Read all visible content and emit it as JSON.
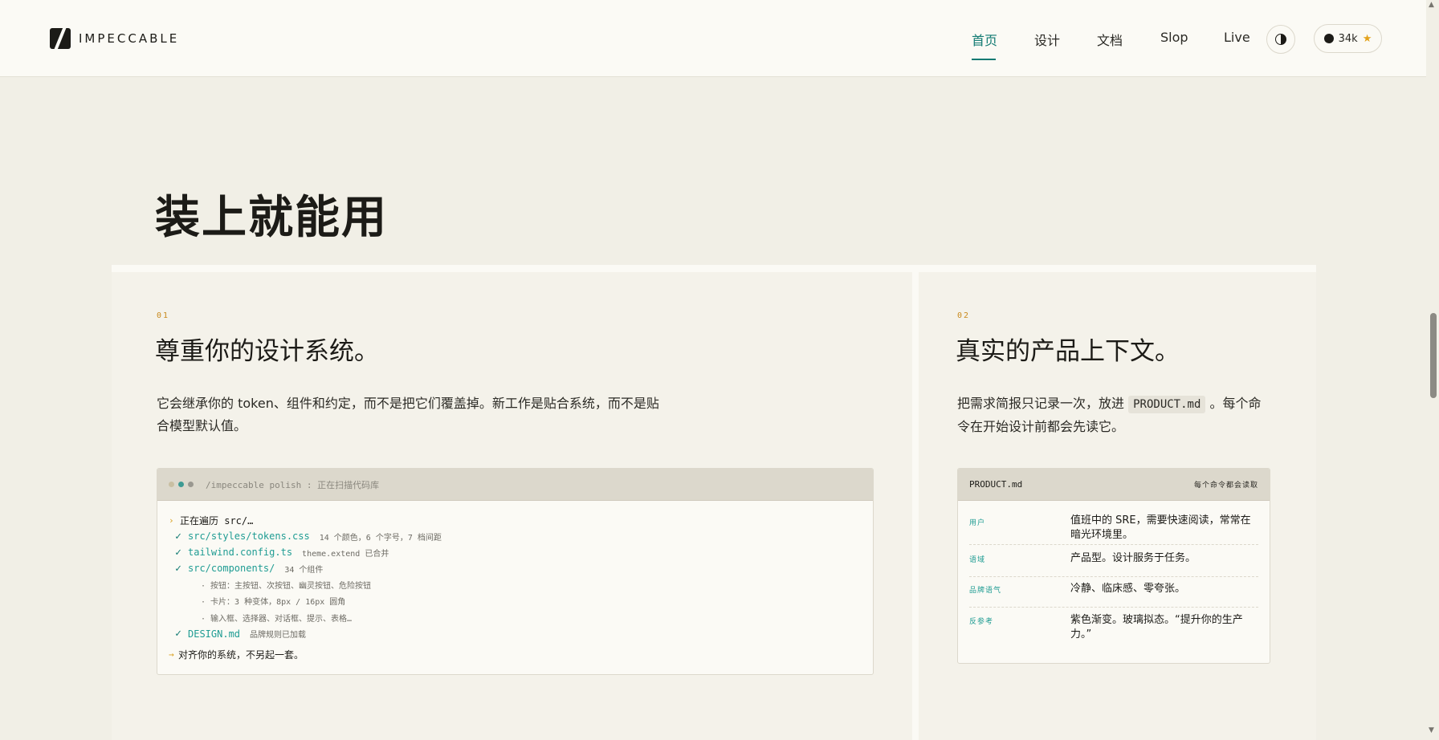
{
  "header": {
    "logo_text": "IMPECCABLE",
    "nav": [
      {
        "label": "首页",
        "active": true
      },
      {
        "label": "设计",
        "active": false
      },
      {
        "label": "文档",
        "active": false
      },
      {
        "label": "Slop",
        "active": false
      },
      {
        "label": "Live",
        "active": false
      }
    ],
    "theme_icon": "half-circle-contrast-icon",
    "github": {
      "icon": "github-icon",
      "stars": "34k",
      "star_icon": "star-icon"
    }
  },
  "section": {
    "title": "装上就能用"
  },
  "cards": [
    {
      "number": "01",
      "title": "尊重你的设计系统。",
      "description": "它会继承你的 token、组件和约定，而不是把它们覆盖掉。新工作是贴合系统，而不是贴合模型默认值。",
      "terminal": {
        "title": "/impeccable polish : 正在扫描代码库",
        "lines": [
          {
            "kind": "prompt",
            "text": "正在遍历 src/…"
          },
          {
            "kind": "check",
            "file": "src/styles/tokens.css",
            "meta": "14 个颜色，6 个字号，7 档间距"
          },
          {
            "kind": "check",
            "file": "tailwind.config.ts",
            "meta": "theme.extend 已合并"
          },
          {
            "kind": "check",
            "file": "src/components/",
            "meta": "34 个组件"
          },
          {
            "kind": "bullet",
            "text": "· 按钮：主按钮、次按钮、幽灵按钮、危险按钮"
          },
          {
            "kind": "bullet",
            "text": "· 卡片：3 种变体，8px / 16px 圆角"
          },
          {
            "kind": "bullet",
            "text": "· 输入框、选择器、对话框、提示、表格…"
          },
          {
            "kind": "check",
            "file": "DESIGN.md",
            "meta": "品牌规则已加载"
          },
          {
            "kind": "arrow",
            "text": "对齐你的系统，不另起一套。"
          }
        ]
      }
    },
    {
      "number": "02",
      "title": "真实的产品上下文。",
      "description_before": "把需求简报只记录一次，放进",
      "description_code": "PRODUCT.md",
      "description_after": "。每个命令在开始设计前都会先读它。",
      "table": {
        "filename": "PRODUCT.md",
        "hint": "每个命令都会读取",
        "rows": [
          {
            "key": "用户",
            "value": "值班中的 SRE，需要快速阅读，常常在暗光环境里。"
          },
          {
            "key": "语域",
            "value": "产品型。设计服务于任务。"
          },
          {
            "key": "品牌语气",
            "value": "冷静、临床感、零夸张。"
          },
          {
            "key": "反参考",
            "value": "紫色渐变。玻璃拟态。“提升你的生产力。”"
          }
        ]
      }
    }
  ],
  "colors": {
    "accent": "#117a72",
    "accent_light": "#1f9c93",
    "highlight": "#c98a1d",
    "background": "#f1efe6",
    "surface": "#fbfaf5",
    "dot_colors": [
      "#c9bfa2",
      "#3e9b93",
      "#9a9890"
    ]
  }
}
